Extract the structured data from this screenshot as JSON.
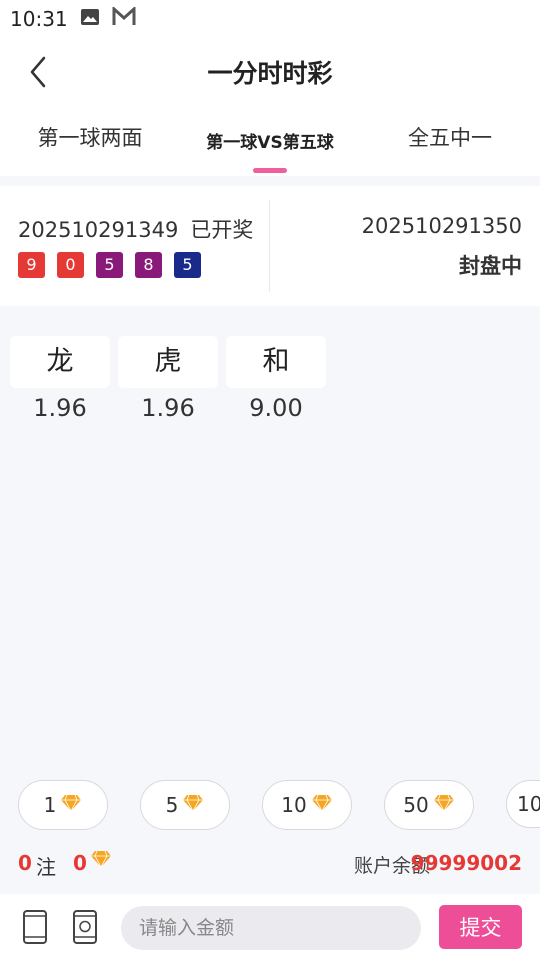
{
  "status_bar": {
    "time": "10:31",
    "icons": [
      "image-icon",
      "mail-icon"
    ]
  },
  "header": {
    "title": "一分时时彩",
    "back_icon": "chevron-left-icon"
  },
  "tabs": [
    {
      "label": "第一球两面",
      "active": false
    },
    {
      "label": "第一球VS第五球",
      "active": true
    },
    {
      "label": "全五中一",
      "active": false
    }
  ],
  "draw": {
    "last_issue": "202510291349",
    "last_status": "已开奖",
    "balls": [
      {
        "value": "9",
        "color": "#e53935"
      },
      {
        "value": "0",
        "color": "#e53935"
      },
      {
        "value": "5",
        "color": "#8a1a7a"
      },
      {
        "value": "8",
        "color": "#8a1a7a"
      },
      {
        "value": "5",
        "color": "#1a2a8a"
      }
    ],
    "next_issue": "202510291350",
    "next_status": "封盘中"
  },
  "bets": [
    {
      "name": "龙",
      "odds": "1.96"
    },
    {
      "name": "虎",
      "odds": "1.96"
    },
    {
      "name": "和",
      "odds": "9.00"
    }
  ],
  "chips": [
    {
      "value": "1"
    },
    {
      "value": "5"
    },
    {
      "value": "10"
    },
    {
      "value": "50"
    },
    {
      "value": "10"
    }
  ],
  "summary": {
    "count": "0",
    "count_unit": "注",
    "amount": "0",
    "balance_label": "账户余额",
    "balance_value": "99999002"
  },
  "bottom": {
    "input_placeholder": "请输入金额",
    "submit_label": "提交"
  },
  "colors": {
    "accent": "#ee4e97",
    "highlight": "#e53935"
  }
}
